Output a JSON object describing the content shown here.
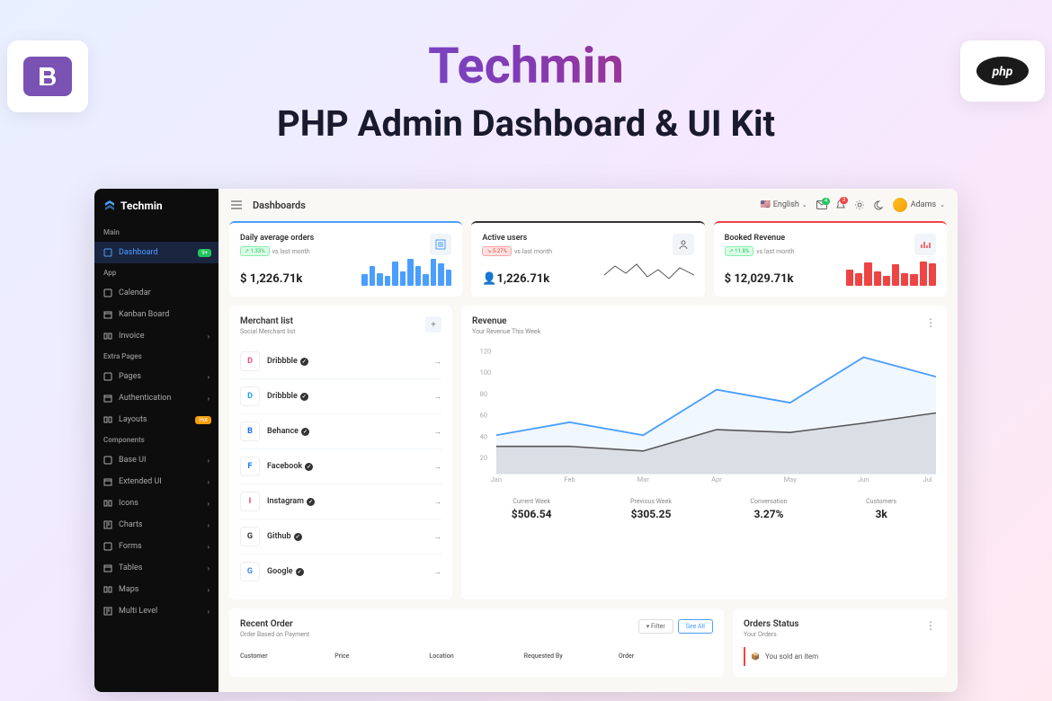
{
  "hero": {
    "title": "Techmin",
    "subtitle": "PHP Admin Dashboard & UI Kit"
  },
  "sidebar": {
    "brand": "Techmin",
    "sections": [
      {
        "label": "Main",
        "items": [
          {
            "label": "Dashboard",
            "active": true,
            "badge": "9+"
          }
        ]
      },
      {
        "label": "App",
        "items": [
          {
            "label": "Calendar"
          },
          {
            "label": "Kanban Board"
          },
          {
            "label": "Invoice",
            "chev": true
          }
        ]
      },
      {
        "label": "Extra Pages",
        "items": [
          {
            "label": "Pages",
            "chev": true
          },
          {
            "label": "Authentication",
            "chev": true
          },
          {
            "label": "Layouts",
            "badge": "Hot",
            "hot": true
          }
        ]
      },
      {
        "label": "Components",
        "items": [
          {
            "label": "Base UI",
            "chev": true
          },
          {
            "label": "Extended UI",
            "chev": true
          },
          {
            "label": "Icons",
            "chev": true
          },
          {
            "label": "Charts",
            "chev": true
          },
          {
            "label": "Forms",
            "chev": true
          },
          {
            "label": "Tables",
            "chev": true
          },
          {
            "label": "Maps",
            "chev": true
          },
          {
            "label": "Multi Level",
            "chev": true
          }
        ]
      }
    ]
  },
  "topbar": {
    "title": "Dashboards",
    "lang": "English",
    "user": "Adams",
    "notif1": "4",
    "notif2": "3"
  },
  "stats": [
    {
      "title": "Daily average orders",
      "change": "1.33%",
      "dir": "up",
      "meta": "vs last month",
      "value": "$ 1,226.71k",
      "color": "blue"
    },
    {
      "title": "Active users",
      "change": "5.27%",
      "dir": "down",
      "meta": "vs last month",
      "value": "1,226.71k",
      "color": "dark"
    },
    {
      "title": "Booked Revenue",
      "change": "11.8%",
      "dir": "up",
      "meta": "vs last month",
      "value": "$ 12,029.71k",
      "color": "red"
    }
  ],
  "merchants": {
    "title": "Merchant list",
    "sub": "Social Merchant list",
    "items": [
      {
        "name": "Dribbble",
        "color": "#ea4c89"
      },
      {
        "name": "Dribbble",
        "color": "#1da1f2"
      },
      {
        "name": "Behance",
        "color": "#1769ff"
      },
      {
        "name": "Facebook",
        "color": "#1877f2"
      },
      {
        "name": "Instagram",
        "color": "#e4405f"
      },
      {
        "name": "Github",
        "color": "#333"
      },
      {
        "name": "Google",
        "color": "#4285f4"
      }
    ]
  },
  "revenue": {
    "title": "Revenue",
    "sub": "Your Revenue This Week",
    "stats": [
      {
        "label": "Current Week",
        "val": "$506.54"
      },
      {
        "label": "Previous Week",
        "val": "$305.25"
      },
      {
        "label": "Conversation",
        "val": "3.27%"
      },
      {
        "label": "Customers",
        "val": "3k"
      }
    ],
    "xlabels": [
      "Jan",
      "Feb",
      "Mar",
      "Apr",
      "May",
      "Jun",
      "Jul"
    ],
    "ylabels": [
      "120",
      "100",
      "80",
      "60",
      "40",
      "20"
    ]
  },
  "chart_data": {
    "type": "line",
    "x": [
      "Jan",
      "Feb",
      "Mar",
      "Apr",
      "May",
      "Jun",
      "Jul"
    ],
    "series": [
      {
        "name": "Current",
        "values": [
          40,
          52,
          40,
          82,
          70,
          112,
          95
        ]
      },
      {
        "name": "Previous",
        "values": [
          30,
          30,
          25,
          45,
          42,
          50,
          60
        ]
      }
    ],
    "ylim": [
      0,
      120
    ]
  },
  "orders": {
    "title": "Recent Order",
    "sub": "Order Based on Payment",
    "filter": "Filter",
    "seeall": "See All",
    "cols": [
      "Customer",
      "Price",
      "Location",
      "Requested By",
      "Order"
    ]
  },
  "status": {
    "title": "Orders Status",
    "sub": "Your Orders",
    "item": "You sold an item"
  }
}
